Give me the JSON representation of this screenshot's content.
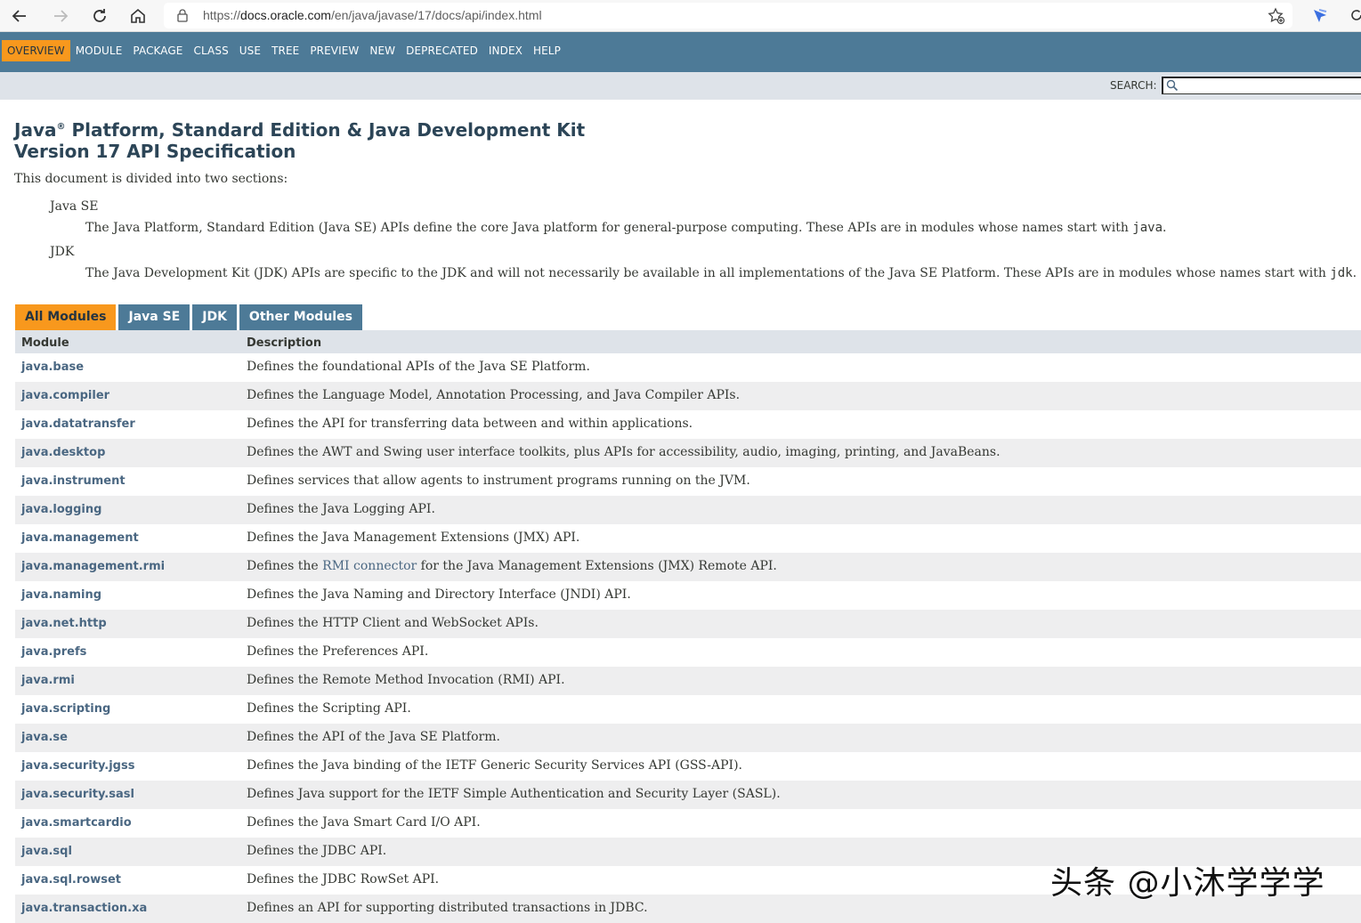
{
  "browser": {
    "url_prefix": "https://",
    "url_host": "docs.oracle.com",
    "url_path": "/en/java/javase/17/docs/api/index.html"
  },
  "nav": {
    "items": [
      "OVERVIEW",
      "MODULE",
      "PACKAGE",
      "CLASS",
      "USE",
      "TREE",
      "PREVIEW",
      "NEW",
      "DEPRECATED",
      "INDEX",
      "HELP"
    ],
    "active": "OVERVIEW",
    "search_label": "SEARCH:"
  },
  "header": {
    "title_java": "Java",
    "title_reg": "®",
    "title_line1_rest": " Platform, Standard Edition & Java Development Kit",
    "title_line2": "Version 17 API Specification"
  },
  "intro": {
    "text": "This document is divided into two sections:",
    "sections": [
      {
        "term": "Java SE",
        "desc": "The Java Platform, Standard Edition (Java SE) APIs define the core Java platform for general-purpose computing. These APIs are in modules whose names start with ",
        "code": "java",
        "suffix": "."
      },
      {
        "term": "JDK",
        "desc": "The Java Development Kit (JDK) APIs are specific to the JDK and will not necessarily be available in all implementations of the Java SE Platform. These APIs are in modules whose names start with ",
        "code": "jdk",
        "suffix": "."
      }
    ]
  },
  "tabs": [
    "All Modules",
    "Java SE",
    "JDK",
    "Other Modules"
  ],
  "table": {
    "headers": [
      "Module",
      "Description"
    ],
    "rows": [
      {
        "module": "java.base",
        "desc": "Defines the foundational APIs of the Java SE Platform."
      },
      {
        "module": "java.compiler",
        "desc": "Defines the Language Model, Annotation Processing, and Java Compiler APIs."
      },
      {
        "module": "java.datatransfer",
        "desc": "Defines the API for transferring data between and within applications."
      },
      {
        "module": "java.desktop",
        "desc": "Defines the AWT and Swing user interface toolkits, plus APIs for accessibility, audio, imaging, printing, and JavaBeans."
      },
      {
        "module": "java.instrument",
        "desc": "Defines services that allow agents to instrument programs running on the JVM."
      },
      {
        "module": "java.logging",
        "desc": "Defines the Java Logging API."
      },
      {
        "module": "java.management",
        "desc": "Defines the Java Management Extensions (JMX) API."
      },
      {
        "module": "java.management.rmi",
        "desc_pre": "Defines the ",
        "desc_link": "RMI connector",
        "desc_post": " for the Java Management Extensions (JMX) Remote API."
      },
      {
        "module": "java.naming",
        "desc": "Defines the Java Naming and Directory Interface (JNDI) API."
      },
      {
        "module": "java.net.http",
        "desc": "Defines the HTTP Client and WebSocket APIs."
      },
      {
        "module": "java.prefs",
        "desc": "Defines the Preferences API."
      },
      {
        "module": "java.rmi",
        "desc": "Defines the Remote Method Invocation (RMI) API."
      },
      {
        "module": "java.scripting",
        "desc": "Defines the Scripting API."
      },
      {
        "module": "java.se",
        "desc": "Defines the API of the Java SE Platform."
      },
      {
        "module": "java.security.jgss",
        "desc": "Defines the Java binding of the IETF Generic Security Services API (GSS-API)."
      },
      {
        "module": "java.security.sasl",
        "desc": "Defines Java support for the IETF Simple Authentication and Security Layer (SASL)."
      },
      {
        "module": "java.smartcardio",
        "desc": "Defines the Java Smart Card I/O API."
      },
      {
        "module": "java.sql",
        "desc": "Defines the JDBC API."
      },
      {
        "module": "java.sql.rowset",
        "desc": "Defines the JDBC RowSet API."
      },
      {
        "module": "java.transaction.xa",
        "desc": "Defines an API for supporting distributed transactions in JDBC."
      }
    ]
  },
  "watermark": "头条 @小沐学学学",
  "colors": {
    "nav_bg": "#4d7a97",
    "nav_active": "#f8981d",
    "subnav_bg": "#dee3e9",
    "link": "#4a6782",
    "title": "#2c4557",
    "row_alt": "#eeeeef"
  }
}
